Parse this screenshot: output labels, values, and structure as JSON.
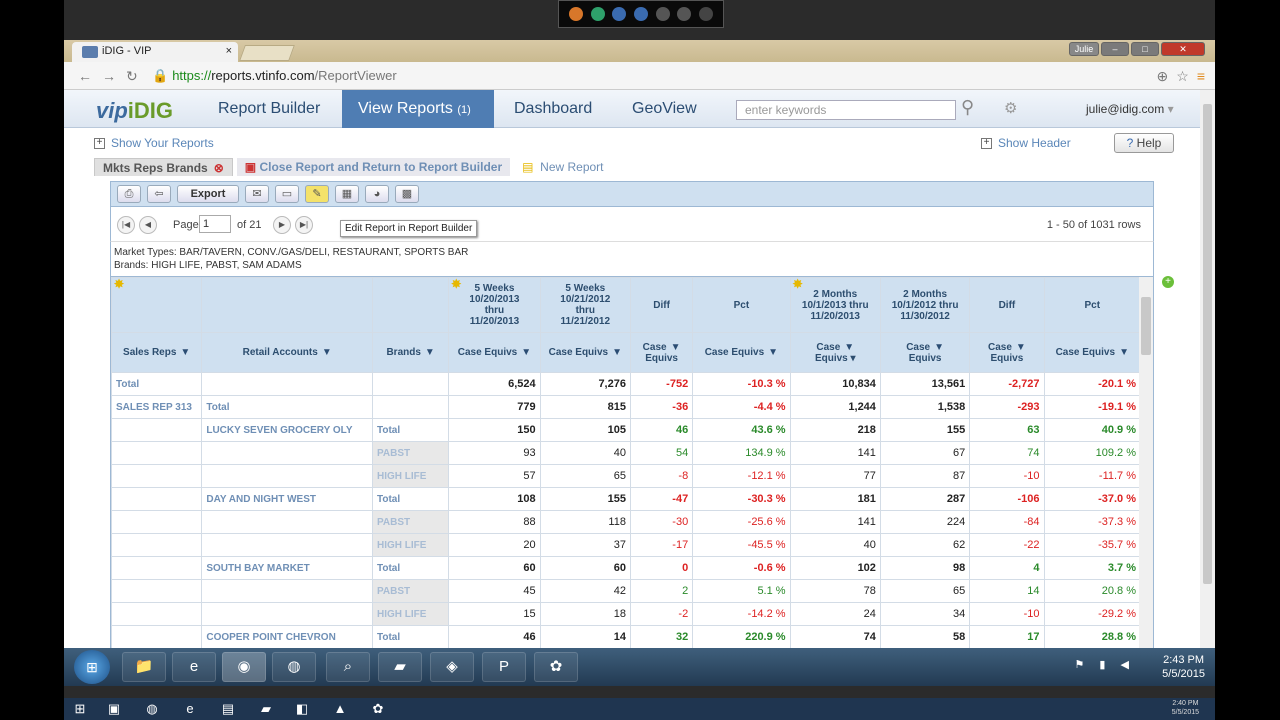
{
  "browser": {
    "tab_title": "iDIG - VIP",
    "tab_close": "×",
    "user_badge": "Julie",
    "url_prefix": "https://",
    "url_domain": "reports.vtinfo.com",
    "url_path": "/ReportViewer"
  },
  "app": {
    "logo_vip": "vip",
    "logo_idig": "iDIG",
    "menu": [
      {
        "label": "Report Builder"
      },
      {
        "label": "View Reports",
        "badge": "(1)"
      },
      {
        "label": "Dashboard"
      },
      {
        "label": "GeoView"
      }
    ],
    "search_placeholder": "enter keywords",
    "user_email": "julie@idig.com",
    "user_caret": "▾",
    "show_reports": "Show Your Reports",
    "show_header": "Show Header",
    "help": "Help"
  },
  "report_tabs": {
    "current": "Mkts Reps Brands",
    "close_icon": "⊗",
    "close_return": "Close Report and Return to Report Builder",
    "new_report": "New Report"
  },
  "toolbar": {
    "export": "Export",
    "tooltip": "Edit Report in Report Builder"
  },
  "pager": {
    "page_label": "Page",
    "page_value": "1",
    "of_label": "of 21",
    "rows_text": "1 - 50 of 1031 rows"
  },
  "filters": {
    "market_types": "Market Types: BAR/TAVERN, CONV./GAS/DELI, RESTAURANT, SPORTS BAR",
    "brands": "Brands: HIGH LIFE, PABST, SAM ADAMS"
  },
  "grid": {
    "groups": [
      {
        "l1": "5 Weeks",
        "l2": "10/20/2013",
        "l3": "thru",
        "l4": "11/20/2013"
      },
      {
        "l1": "5 Weeks",
        "l2": "10/21/2012",
        "l3": "thru",
        "l4": "11/21/2012"
      },
      {
        "l1": "Diff"
      },
      {
        "l1": "Pct"
      },
      {
        "l1": "2 Months",
        "l2": "10/1/2013 thru",
        "l3": "11/20/2013"
      },
      {
        "l1": "2 Months",
        "l2": "10/1/2012 thru",
        "l3": "11/30/2012"
      },
      {
        "l1": "Diff"
      },
      {
        "l1": "Pct"
      }
    ],
    "columns": [
      "Sales Reps",
      "Retail Accounts",
      "Brands",
      "Case Equivs",
      "Case Equivs",
      "Case",
      "Case Equivs",
      "Case",
      "Case",
      "Case",
      "Case Equivs"
    ],
    "col_sub": [
      "",
      "",
      "",
      "",
      "",
      "Equivs",
      "",
      "Equivs ▾",
      "Equivs",
      "Equivs",
      ""
    ],
    "rows": [
      [
        "Total",
        "",
        "",
        "6,524",
        "7,276",
        "-752",
        "-10.3 %",
        "10,834",
        "13,561",
        "-2,727",
        "-20.1 %"
      ],
      [
        "SALES REP 313",
        "Total",
        "",
        "779",
        "815",
        "-36",
        "-4.4 %",
        "1,244",
        "1,538",
        "-293",
        "-19.1 %"
      ],
      [
        "",
        "LUCKY SEVEN GROCERY OLY",
        "Total",
        "150",
        "105",
        "46",
        "43.6 %",
        "218",
        "155",
        "63",
        "40.9 %"
      ],
      [
        "",
        "",
        "PABST",
        "93",
        "40",
        "54",
        "134.9 %",
        "141",
        "67",
        "74",
        "109.2 %"
      ],
      [
        "",
        "",
        "HIGH LIFE",
        "57",
        "65",
        "-8",
        "-12.1 %",
        "77",
        "87",
        "-10",
        "-11.7 %"
      ],
      [
        "",
        "DAY AND NIGHT WEST",
        "Total",
        "108",
        "155",
        "-47",
        "-30.3 %",
        "181",
        "287",
        "-106",
        "-37.0 %"
      ],
      [
        "",
        "",
        "PABST",
        "88",
        "118",
        "-30",
        "-25.6 %",
        "141",
        "224",
        "-84",
        "-37.3 %"
      ],
      [
        "",
        "",
        "HIGH LIFE",
        "20",
        "37",
        "-17",
        "-45.5 %",
        "40",
        "62",
        "-22",
        "-35.7 %"
      ],
      [
        "",
        "SOUTH BAY MARKET",
        "Total",
        "60",
        "60",
        "0",
        "-0.6 %",
        "102",
        "98",
        "4",
        "3.7 %"
      ],
      [
        "",
        "",
        "PABST",
        "45",
        "42",
        "2",
        "5.1 %",
        "78",
        "65",
        "14",
        "20.8 %"
      ],
      [
        "",
        "",
        "HIGH LIFE",
        "15",
        "18",
        "-2",
        "-14.2 %",
        "24",
        "34",
        "-10",
        "-29.2 %"
      ],
      [
        "",
        "COOPER POINT CHEVRON",
        "Total",
        "46",
        "14",
        "32",
        "220.9 %",
        "74",
        "58",
        "17",
        "28.8 %"
      ]
    ]
  },
  "taskbar": {
    "time": "2:43 PM",
    "date": "5/5/2015",
    "time2": "2:40 PM",
    "date2": "5/5/2015"
  },
  "colors": {
    "positive": "#2a8a2a",
    "negative": "#d22222",
    "header_bg": "#cfe0f0",
    "active_menu": "#4f7db3"
  }
}
